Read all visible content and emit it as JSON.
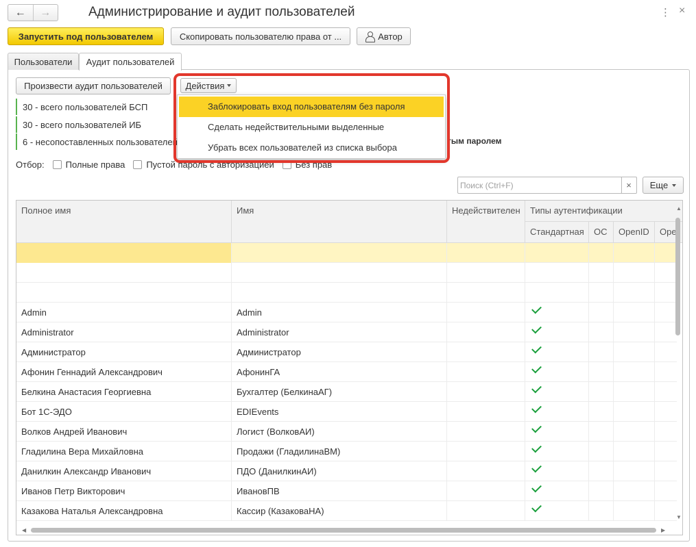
{
  "window": {
    "title": "Администрирование и аудит пользователей",
    "back_icon": "←",
    "forward_icon": "→",
    "menu_icon": "⋮",
    "close_icon": "×"
  },
  "toolbar": {
    "run_as_user": "Запустить под пользователем",
    "copy_rights": "Скопировать пользователю права от ...",
    "author": "Автор"
  },
  "tabs": [
    {
      "label": "Пользователи"
    },
    {
      "label": "Аудит пользователей"
    }
  ],
  "audit": {
    "run_audit": "Произвести аудит пользователей",
    "actions": "Действия",
    "info": [
      "30 - всего пользователей БСП",
      "30 - всего пользователей ИБ",
      "6 - несопоставленных пользователей"
    ],
    "info_tail": "тым паролем"
  },
  "filter": {
    "label": "Отбор:",
    "items": [
      "Полные права",
      "Пустой пароль с авторизацией",
      "Без прав"
    ]
  },
  "search": {
    "placeholder": "Поиск (Ctrl+F)",
    "clear": "×",
    "more": "Еще"
  },
  "table": {
    "headers": {
      "full_name": "Полное имя",
      "name": "Имя",
      "invalid": "Недействителен",
      "auth_types": "Типы аутентификации",
      "standard": "Стандартная",
      "os": "ОС",
      "openid": "OpenID",
      "more": "Оре"
    },
    "rows": [
      {
        "full_name": "",
        "name": ""
      },
      {
        "full_name": "",
        "name": ""
      },
      {
        "full_name": "",
        "name": ""
      },
      {
        "full_name": "Admin",
        "name": "Admin"
      },
      {
        "full_name": "Administrator",
        "name": "Administrator"
      },
      {
        "full_name": "Администратор",
        "name": "Администратор"
      },
      {
        "full_name": "Афонин Геннадий Александрович",
        "name": "АфонинГА"
      },
      {
        "full_name": "Белкина Анастасия Георгиевна",
        "name": "Бухгалтер (БелкинаАГ)"
      },
      {
        "full_name": "Бот 1С-ЭДО",
        "name": "EDIEvents"
      },
      {
        "full_name": "Волков Андрей Иванович",
        "name": "Логист (ВолковАИ)"
      },
      {
        "full_name": "Гладилина Вера Михайловна",
        "name": "Продажи (ГладилинаВМ)"
      },
      {
        "full_name": "Данилкин Александр Иванович",
        "name": "ПДО (ДанилкинАИ)"
      },
      {
        "full_name": "Иванов Петр Викторович",
        "name": "ИвановПВ"
      },
      {
        "full_name": "Казакова Наталья Александровна",
        "name": "Кассир (КазаковаНА)"
      }
    ]
  },
  "menu": {
    "items": [
      "Заблокировать вход пользователям без пароля",
      "Сделать недействительными выделенные",
      "Убрать всех пользователей из списка выбора"
    ]
  }
}
